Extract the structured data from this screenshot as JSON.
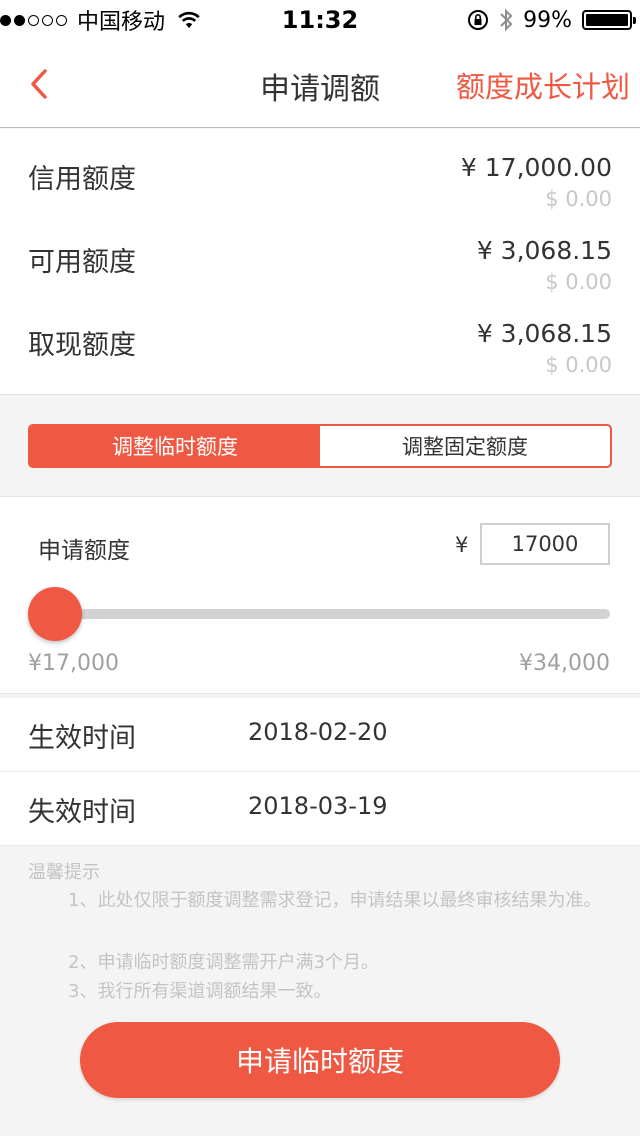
{
  "status_bar": {
    "carrier": "中国移动",
    "time": "11:32",
    "battery": "99%",
    "battery_level": 0.99,
    "signal_bars": 2,
    "signal_total": 5
  },
  "nav": {
    "back_icon": "chevron-left-icon",
    "title": "申请调额",
    "action": "额度成长计划"
  },
  "summary": [
    {
      "label": "信用额度",
      "rmb": "¥ 17,000.00",
      "usd": "$ 0.00"
    },
    {
      "label": "可用额度",
      "rmb": "¥ 3,068.15",
      "usd": "$ 0.00"
    },
    {
      "label": "取现额度",
      "rmb": "¥ 3,068.15",
      "usd": "$ 0.00"
    }
  ],
  "tabs": [
    {
      "label": "调整临时额度",
      "active": true
    },
    {
      "label": "调整固定额度",
      "active": false
    }
  ],
  "apply": {
    "label": "申请额度",
    "currency": "¥",
    "amount": "17000",
    "slider_value": 17000,
    "min_label": "¥17,000",
    "max_label": "¥34,000"
  },
  "dates": [
    {
      "label": "生效时间",
      "value": "2018-02-20"
    },
    {
      "label": "失效时间",
      "value": "2018-03-19"
    }
  ],
  "tips": {
    "title": "温馨提示",
    "items": [
      "1、此处仅限于额度调整需求登记，申请结果以最终审核结果为准。",
      "2、申请临时额度调整需开户满3个月。",
      "3、我行所有渠道调额结果一致。"
    ]
  },
  "submit_label": "申请临时额度",
  "colors": {
    "accent": "#ef5842",
    "muted": "#c4c4c4"
  }
}
